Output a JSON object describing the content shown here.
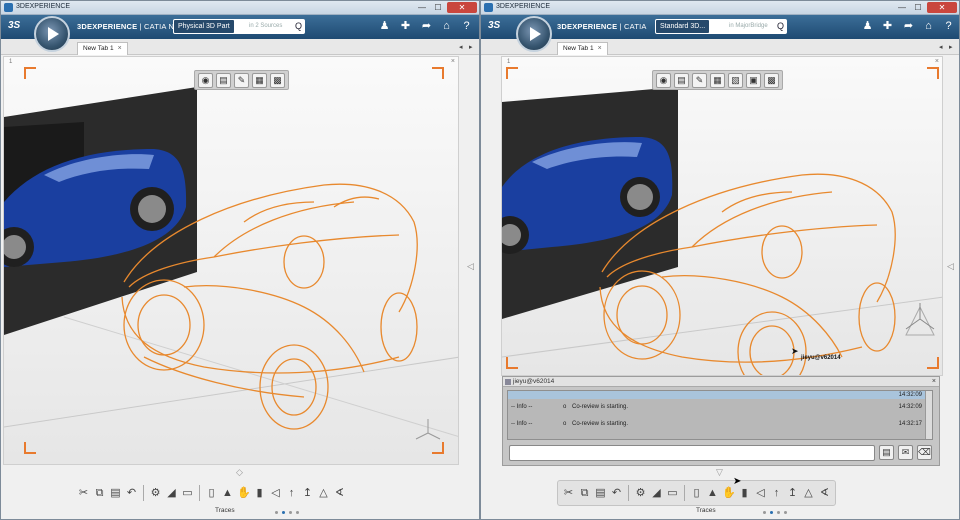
{
  "left": {
    "window_title": "3DEXPERIENCE",
    "brand_bold": "3DEXPERIENCE",
    "brand_rest": " | CATIA N",
    "search_selector": "Physical 3D Part",
    "search_placeholder": "in 2 Sources",
    "tab_label": "New Tab 1",
    "viewer_number": "1",
    "traces_label": "Traces"
  },
  "right": {
    "window_title": "3DEXPERIENCE",
    "brand_bold": "3DEXPERIENCE",
    "brand_rest": " | CATIA",
    "search_selector": "Standard 3D...",
    "search_placeholder": "in MajorBridge",
    "tab_label": "New Tab 1",
    "viewer_number": "1",
    "cursor_user_label": "jieyu@v62014",
    "traces_label": "Traces",
    "chat": {
      "title": "jieyu@v62014",
      "rows": [
        {
          "source": "-- Info --",
          "bullet": "o",
          "message": "Co-review is starting.",
          "time": "14:32:09"
        },
        {
          "source": "-- Info --",
          "bullet": "o",
          "message": "Co-review is starting.",
          "time": "14:32:17"
        }
      ],
      "top_time": "14:32:09"
    }
  },
  "ui": {
    "ds_logo": "3S",
    "window_minimize": "—",
    "window_maximize": "☐",
    "window_close": "✕",
    "search_glyph": "Q",
    "close_x": "×",
    "tab_prev": "◂",
    "tab_next": "▸",
    "panel_close": "×",
    "expander_up": "◇",
    "expander_down": "▽",
    "side_arrow": "◁"
  },
  "icons": {
    "topbar": [
      "user-icon",
      "add-icon",
      "share-icon",
      "home-icon",
      "help-icon"
    ],
    "context_toolbar_left": [
      "camera-icon",
      "clipboard-icon",
      "pencil-icon",
      "windows-icon",
      "window-settings-icon"
    ],
    "context_toolbar_right": [
      "camera-icon",
      "clipboard-icon",
      "pencil-icon",
      "windows-icon",
      "screen-share-icon",
      "window-icon",
      "window-settings-icon"
    ],
    "bottom_toolbar": [
      "cut-icon",
      "copy-icon",
      "paste-icon",
      "undo-icon",
      "settings-gear-icon",
      "paint-icon",
      "sheet-icon",
      "page-icon",
      "fill-icon",
      "hand-icon",
      "bottle-icon",
      "shape-icon",
      "arrow-up-icon",
      "arrow-pin-icon",
      "figure-icon",
      "measure-icon"
    ]
  },
  "colors": {
    "appbar": "#1e4a72",
    "sketch_orange": "#e8892e",
    "viewer_corner": "#e87a2e",
    "car_blue": "#1a3fa0",
    "chat_bg": "#c6c6c6",
    "highlight_blue": "#2a6fb0"
  }
}
